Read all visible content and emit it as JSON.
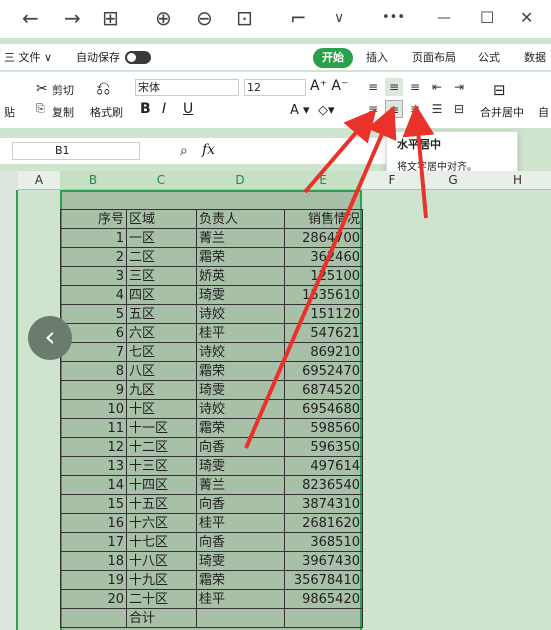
{
  "nav": {
    "back": "←",
    "forward": "→",
    "grid": "⊞",
    "zoom_in": "⊕",
    "zoom_out": "⊖",
    "fit": "⊡",
    "crop": "⌐",
    "dropdown": "∨",
    "more": "•••",
    "minimize": "—",
    "maximize": "☐",
    "close": "✕"
  },
  "menu": {
    "file": "三 文件 ∨",
    "autosave": "自动保存",
    "start": "开始",
    "insert": "插入",
    "layout": "页面布局",
    "formula": "公式",
    "data": "数据"
  },
  "ribbon": {
    "cut": "剪切",
    "copy": "复制",
    "painter": "格式刷",
    "font": "宋体",
    "size": "12",
    "bold": "B",
    "italic": "I",
    "underline": "U",
    "merge": "合并居中",
    "paste": "贴",
    "auto": "自"
  },
  "tooltip": {
    "title": "水平居中",
    "desc": "将文字居中对齐。"
  },
  "formula": {
    "cell": "B1",
    "fx": "fx"
  },
  "columns": [
    "A",
    "B",
    "C",
    "D",
    "E",
    "F",
    "G",
    "H"
  ],
  "headers": [
    "序号",
    "区域",
    "负责人",
    "销售情况"
  ],
  "rows": [
    [
      "1",
      "一区",
      "菁兰",
      "2864700"
    ],
    [
      "2",
      "二区",
      "霜荣",
      "362460"
    ],
    [
      "3",
      "三区",
      "娇英",
      "125100"
    ],
    [
      "4",
      "四区",
      "琦雯",
      "1535610"
    ],
    [
      "5",
      "五区",
      "诗姣",
      "151120"
    ],
    [
      "6",
      "六区",
      "桂平",
      "547621"
    ],
    [
      "7",
      "七区",
      "诗姣",
      "869210"
    ],
    [
      "8",
      "八区",
      "霜荣",
      "6952470"
    ],
    [
      "9",
      "九区",
      "琦雯",
      "6874520"
    ],
    [
      "10",
      "十区",
      "诗姣",
      "6954680"
    ],
    [
      "11",
      "十一区",
      "霜荣",
      "598560"
    ],
    [
      "12",
      "十二区",
      "向香",
      "596350"
    ],
    [
      "13",
      "十三区",
      "琦雯",
      "497614"
    ],
    [
      "14",
      "十四区",
      "菁兰",
      "8236540"
    ],
    [
      "15",
      "十五区",
      "向香",
      "3874310"
    ],
    [
      "16",
      "十六区",
      "桂平",
      "2681620"
    ],
    [
      "17",
      "十七区",
      "向香",
      "368510"
    ],
    [
      "18",
      "十八区",
      "琦雯",
      "3967430"
    ],
    [
      "19",
      "十九区",
      "霜荣",
      "35678410"
    ],
    [
      "20",
      "二十区",
      "桂平",
      "9865420"
    ]
  ],
  "total": "合计",
  "colors": {
    "accent": "#2ba04a",
    "arrow": "#e8322a",
    "sheet": "#cfe4cf"
  }
}
